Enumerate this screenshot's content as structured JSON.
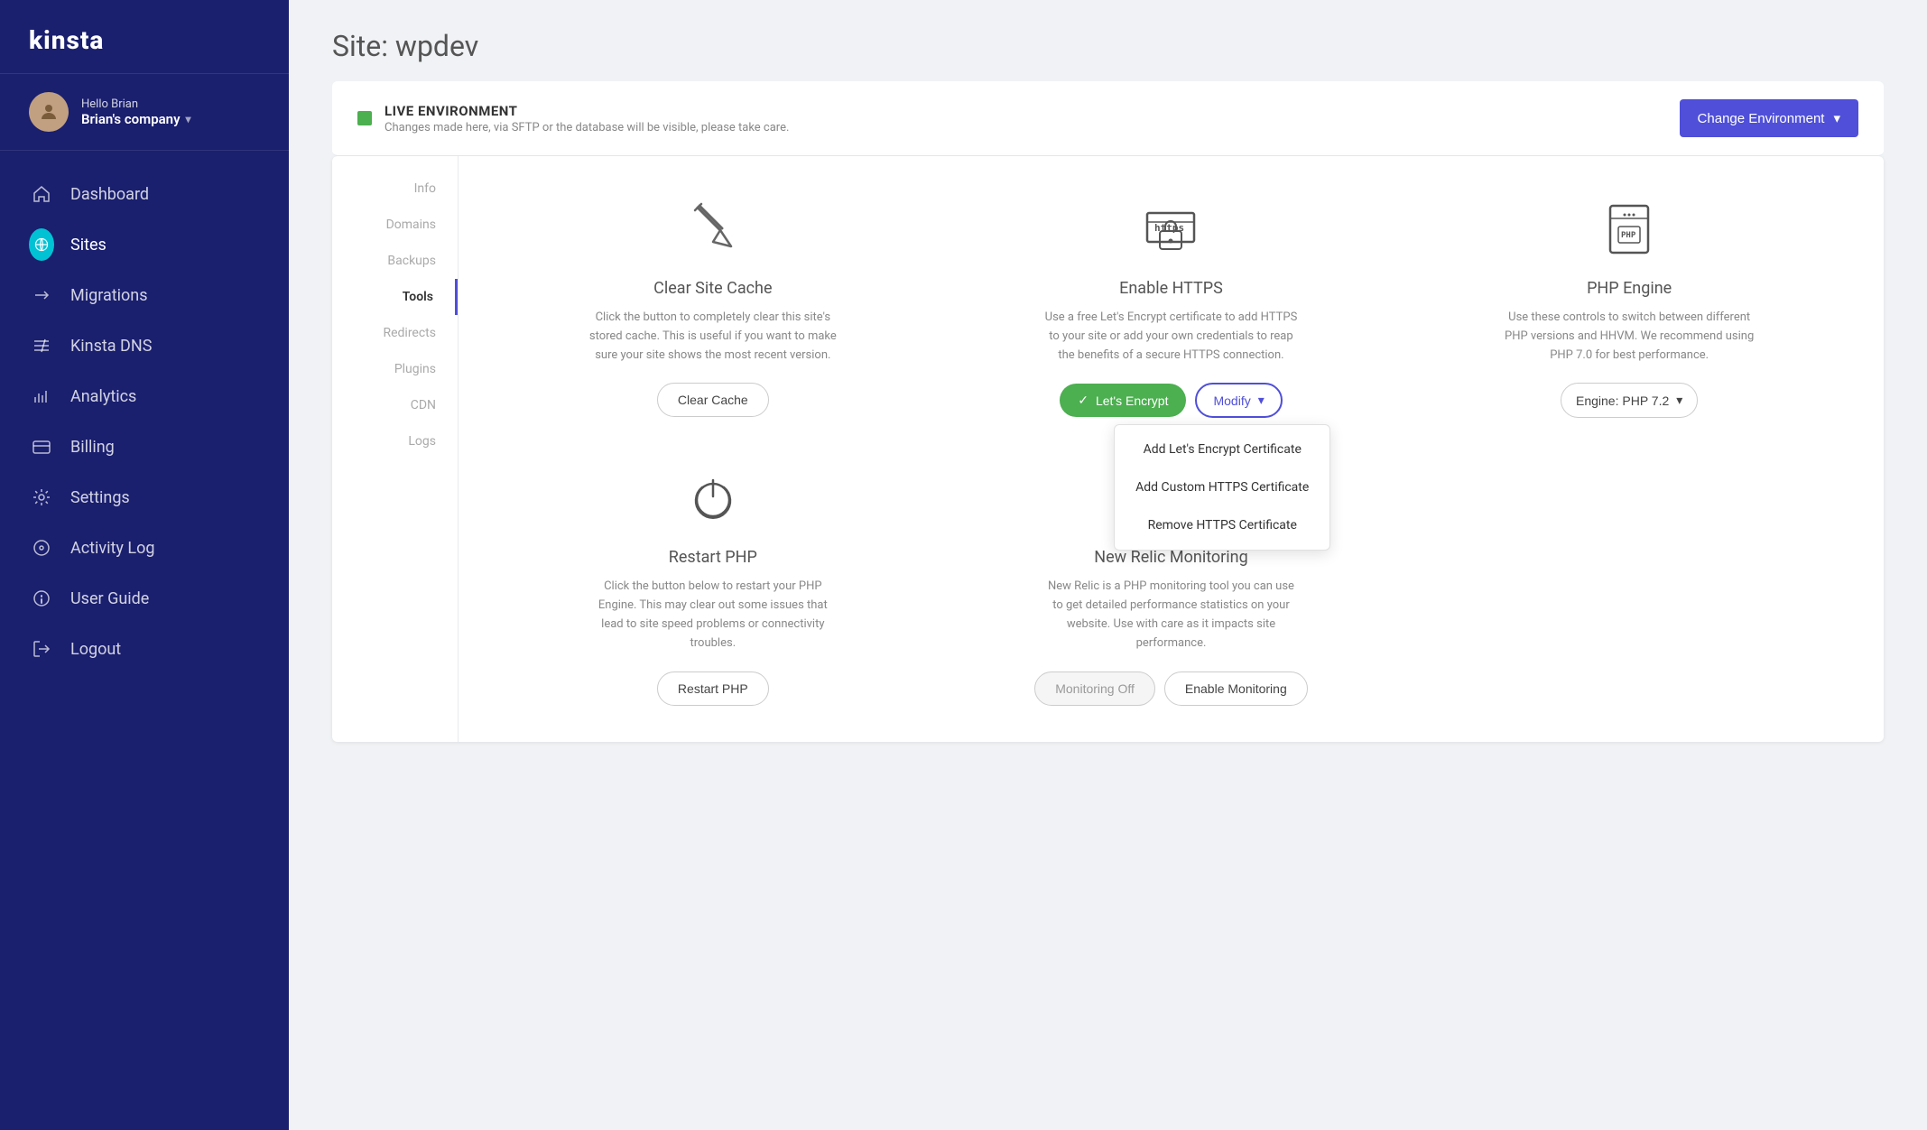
{
  "brand": {
    "name": "kinsta"
  },
  "user": {
    "greeting": "Hello Brian",
    "company": "Brian's company"
  },
  "sidebar": {
    "items": [
      {
        "label": "Dashboard",
        "icon": "home"
      },
      {
        "label": "Sites",
        "icon": "sites",
        "active": true
      },
      {
        "label": "Migrations",
        "icon": "migrations"
      },
      {
        "label": "Kinsta DNS",
        "icon": "dns"
      },
      {
        "label": "Analytics",
        "icon": "analytics"
      },
      {
        "label": "Billing",
        "icon": "billing"
      },
      {
        "label": "Settings",
        "icon": "settings"
      },
      {
        "label": "Activity Log",
        "icon": "activity"
      },
      {
        "label": "User Guide",
        "icon": "guide"
      },
      {
        "label": "Logout",
        "icon": "logout"
      }
    ]
  },
  "page": {
    "title": "Site: wpdev"
  },
  "environment": {
    "label": "LIVE ENVIRONMENT",
    "description": "Changes made here, via SFTP or the database will be visible, please take care.",
    "changeButton": "Change Environment"
  },
  "subnav": {
    "items": [
      {
        "label": "Info",
        "active": false
      },
      {
        "label": "Domains",
        "active": false
      },
      {
        "label": "Backups",
        "active": false
      },
      {
        "label": "Tools",
        "active": true
      },
      {
        "label": "Redirects",
        "active": false
      },
      {
        "label": "Plugins",
        "active": false
      },
      {
        "label": "CDN",
        "active": false
      },
      {
        "label": "Logs",
        "active": false
      }
    ]
  },
  "tools": {
    "clearCache": {
      "title": "Clear Site Cache",
      "description": "Click the button to completely clear this site's stored cache. This is useful if you want to make sure your site shows the most recent version.",
      "buttonLabel": "Clear Cache"
    },
    "enableHttps": {
      "title": "Enable HTTPS",
      "description": "Use a free Let's Encrypt certificate to add HTTPS to your site or add your own credentials to reap the benefits of a secure HTTPS connection.",
      "letsEncryptLabel": "Let's Encrypt",
      "modifyLabel": "Modify",
      "dropdown": [
        {
          "label": "Add Let's Encrypt Certificate"
        },
        {
          "label": "Add Custom HTTPS Certificate"
        },
        {
          "label": "Remove HTTPS Certificate"
        }
      ]
    },
    "phpEngine": {
      "title": "PHP Engine",
      "description": "Use these controls to switch between different PHP versions and HHVM. We recommend using PHP 7.0 for best performance.",
      "engineLabel": "Engine: PHP 7.2"
    },
    "restartPhp": {
      "title": "Restart PHP",
      "description": "Click the button below to restart your PHP Engine. This may clear out some issues that lead to site speed problems or connectivity troubles.",
      "buttonLabel": "Restart PHP"
    },
    "newRelic": {
      "title": "New Relic Monitoring",
      "description": "New Relic is a PHP monitoring tool you can use to get detailed performance statistics on your website. Use with care as it impacts site performance.",
      "monitoringOffLabel": "Monitoring Off",
      "enableMonitoringLabel": "Enable Monitoring"
    }
  }
}
